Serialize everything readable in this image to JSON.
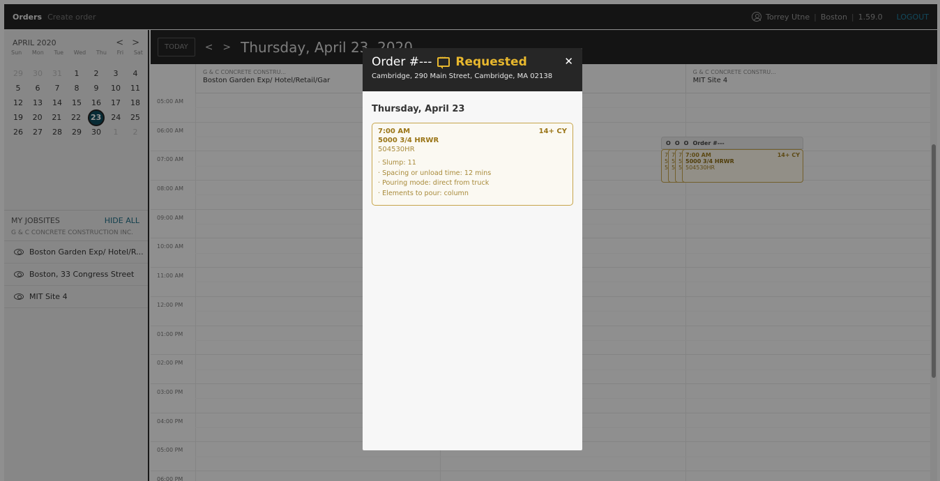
{
  "topbar": {
    "nav_orders": "Orders",
    "nav_create": "Create order",
    "user_name": "Torrey Utne",
    "location": "Boston",
    "version": "1.59.0",
    "separator": "|",
    "logout": "LOGOUT"
  },
  "mini_calendar": {
    "month": "APRIL 2020",
    "prev": "<",
    "next": ">",
    "days_of_week": [
      "Sun",
      "Mon",
      "Tue",
      "Wed",
      "Thu",
      "Fri",
      "Sat"
    ],
    "weeks": [
      [
        "29",
        "30",
        "31",
        "1",
        "2",
        "3",
        "4"
      ],
      [
        "5",
        "6",
        "7",
        "8",
        "9",
        "10",
        "11"
      ],
      [
        "12",
        "13",
        "14",
        "15",
        "16",
        "17",
        "18"
      ],
      [
        "19",
        "20",
        "21",
        "22",
        "23",
        "24",
        "25"
      ],
      [
        "26",
        "27",
        "28",
        "29",
        "30",
        "1",
        "2"
      ]
    ],
    "selected_day": "23"
  },
  "jobsites": {
    "title": "MY JOBSITES",
    "hide_all": "HIDE ALL",
    "company": "G & C CONCRETE CONSTRUCTION INC.",
    "items": [
      "Boston Garden Exp/ Hotel/R...",
      "Boston, 33 Congress Street",
      "MIT Site 4"
    ]
  },
  "day_view": {
    "today_button": "TODAY",
    "prev": "<",
    "next": ">",
    "title": "Thursday, April 23, 2020",
    "columns": [
      {
        "company": "G & C CONCRETE CONSTRU...",
        "site": "Boston Garden Exp/ Hotel/Retail/Gar"
      },
      {
        "company": "",
        "site": ""
      },
      {
        "company": "G & C CONCRETE CONSTRU...",
        "site": "MIT Site 4"
      }
    ],
    "times": [
      "05:00 AM",
      "06:00 AM",
      "07:00 AM",
      "08:00 AM",
      "09:00 AM",
      "10:00 AM",
      "11:00 AM",
      "12:00 PM",
      "01:00 PM",
      "02:00 PM",
      "03:00 PM",
      "04:00 PM",
      "05:00 PM",
      "06:00 PM"
    ],
    "event_stack": {
      "header_letters": [
        "O",
        "O",
        "O"
      ],
      "header_title": "Order #---",
      "card_time": "7:00 AM",
      "card_qty": "14+ CY",
      "card_product": "5000 3/4 HRWR",
      "card_code": "504530HR",
      "partial_time": "7:",
      "partial_product": "5(",
      "partial_code": "5("
    }
  },
  "modal": {
    "title": "Order #---",
    "status": "Requested",
    "close": "✕",
    "address": "Cambridge, 290 Main Street, Cambridge, MA 02138",
    "date": "Thursday, April 23",
    "order": {
      "time": "7:00 AM",
      "quantity": "14+ CY",
      "product": "5000 3/4 HRWR",
      "code": "504530HR",
      "details": [
        "· Slump: 11",
        "· Spacing or unload time: 12 mins",
        "· Pouring mode: direct from truck",
        "· Elements to pour: column"
      ]
    }
  },
  "colors": {
    "topbar": "#242424",
    "accent_teal": "#0f4b5c",
    "status_yellow": "#e8b82e",
    "order_gold": "#a07e22"
  }
}
